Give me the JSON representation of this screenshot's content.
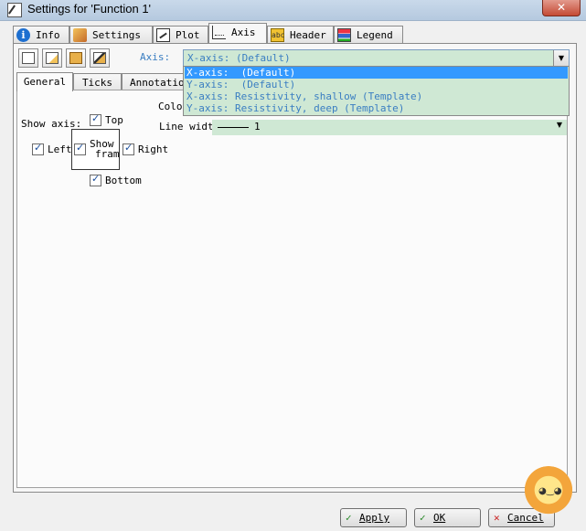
{
  "window": {
    "title": "Settings for 'Function 1'",
    "close_glyph": "✕"
  },
  "tabs": [
    {
      "label": "Info",
      "icon": "info-icon"
    },
    {
      "label": "Settings",
      "icon": "settings-icon"
    },
    {
      "label": "Plot",
      "icon": "plot-icon"
    },
    {
      "label": "Axis",
      "icon": "axis-icon",
      "active": true
    },
    {
      "label": "Header",
      "icon": "header-icon"
    },
    {
      "label": "Legend",
      "icon": "legend-icon"
    }
  ],
  "header_icon_text": "abc",
  "toolbar": {
    "icons": [
      "new-template-icon",
      "new-axis-icon",
      "open-folder-icon",
      "paint-icon"
    ]
  },
  "axis_selector": {
    "label": "Axis:",
    "value": "X-axis:  (Default)",
    "options": [
      "X-axis:  (Default)",
      "Y-axis:  (Default)",
      "X-axis: Resistivity, shallow (Template)",
      "Y-axis: Resistivity, deep (Template)"
    ],
    "selected_index": 0
  },
  "inner_tabs": [
    "General",
    "Ticks",
    "Annotation"
  ],
  "general": {
    "show_axis_label": "Show axis:",
    "top": "Top",
    "left": "Left",
    "show_frame_line1": "Show",
    "show_frame_line2": "frame",
    "right": "Right",
    "bottom": "Bottom",
    "color_label": "Color",
    "line_width_label": "Line width",
    "line_width_value": "1"
  },
  "buttons": {
    "apply": "Apply",
    "ok": "OK",
    "cancel": "Cancel"
  },
  "colors": {
    "field_bg": "#cfe8d4",
    "selected": "#3399ff",
    "link_text": "#3a7ec2"
  }
}
